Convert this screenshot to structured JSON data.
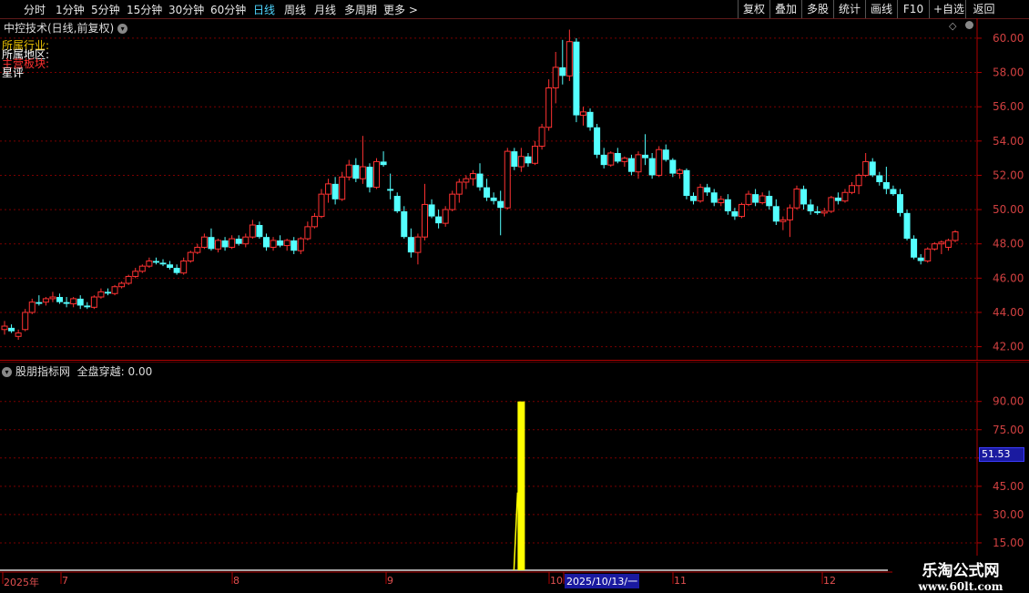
{
  "toolbar": {
    "periods": [
      "分时",
      "1分钟",
      "5分钟",
      "15分钟",
      "30分钟",
      "60分钟",
      "日线",
      "周线",
      "月线",
      "多周期",
      "更多 >"
    ],
    "active_period": "日线",
    "right_buttons": [
      "复权",
      "叠加",
      "多股",
      "统计",
      "画线",
      "F10",
      "+自选",
      "返回"
    ]
  },
  "main_panel": {
    "title": "中控技术(日线,前复权)",
    "info_lines": [
      {
        "label": "所属行业:",
        "color": "#e8c000"
      },
      {
        "label": "所属地区:",
        "color": "#ffffff"
      },
      {
        "label": "主营板块:",
        "color": "#ff3030"
      },
      {
        "label": "星评",
        "color": "#ffffff"
      }
    ],
    "y_ticks": [
      "60.00",
      "58.00",
      "56.00",
      "54.00",
      "52.00",
      "50.00",
      "48.00",
      "46.00",
      "44.00",
      "42.00"
    ],
    "up_color": "#ff3232",
    "down_color": "#54ffff"
  },
  "sub_panel": {
    "title": "股朋指标网",
    "indicator_label": "全盘穿越: 0.00",
    "y_ticks": [
      "90.00",
      "75.00",
      "60.00",
      "45.00",
      "30.00",
      "15.00"
    ],
    "current_value_box": "51.53",
    "signal_color": "#ffff00"
  },
  "x_axis": {
    "labels": [
      {
        "text": "2025年"
      },
      {
        "text": "7"
      },
      {
        "text": "8"
      },
      {
        "text": "9"
      },
      {
        "text": "10"
      },
      {
        "text": "2025/10/13/一",
        "highlight": true
      },
      {
        "text": "11"
      },
      {
        "text": "12"
      }
    ]
  },
  "watermark": {
    "line1": "乐淘公式网",
    "line2": "www.60lt.com"
  },
  "chart_data": {
    "type": "candlestick",
    "y_range": [
      41.5,
      60.9
    ],
    "candles": [
      {
        "o": 43.0,
        "h": 43.5,
        "l": 42.7,
        "c": 43.2
      },
      {
        "o": 43.1,
        "h": 43.3,
        "l": 42.8,
        "c": 42.9
      },
      {
        "o": 42.6,
        "h": 43.0,
        "l": 42.4,
        "c": 42.8
      },
      {
        "o": 43.0,
        "h": 44.2,
        "l": 42.9,
        "c": 44.0
      },
      {
        "o": 44.0,
        "h": 44.8,
        "l": 43.9,
        "c": 44.6
      },
      {
        "o": 44.6,
        "h": 45.0,
        "l": 44.4,
        "c": 44.5
      },
      {
        "o": 44.6,
        "h": 44.9,
        "l": 44.4,
        "c": 44.8
      },
      {
        "o": 44.8,
        "h": 45.2,
        "l": 44.6,
        "c": 44.9
      },
      {
        "o": 44.9,
        "h": 45.1,
        "l": 44.5,
        "c": 44.6
      },
      {
        "o": 44.6,
        "h": 44.9,
        "l": 44.3,
        "c": 44.5
      },
      {
        "o": 44.5,
        "h": 44.9,
        "l": 44.3,
        "c": 44.8
      },
      {
        "o": 44.8,
        "h": 45.0,
        "l": 44.2,
        "c": 44.4
      },
      {
        "o": 44.4,
        "h": 44.6,
        "l": 44.2,
        "c": 44.3
      },
      {
        "o": 44.3,
        "h": 45.0,
        "l": 44.2,
        "c": 44.9
      },
      {
        "o": 44.9,
        "h": 45.4,
        "l": 44.8,
        "c": 45.2
      },
      {
        "o": 45.2,
        "h": 45.4,
        "l": 45.0,
        "c": 45.1
      },
      {
        "o": 45.1,
        "h": 45.6,
        "l": 45.0,
        "c": 45.5
      },
      {
        "o": 45.5,
        "h": 45.8,
        "l": 45.4,
        "c": 45.7
      },
      {
        "o": 45.7,
        "h": 46.2,
        "l": 45.6,
        "c": 46.1
      },
      {
        "o": 46.1,
        "h": 46.6,
        "l": 46.0,
        "c": 46.4
      },
      {
        "o": 46.4,
        "h": 46.8,
        "l": 46.3,
        "c": 46.7
      },
      {
        "o": 46.7,
        "h": 47.2,
        "l": 46.6,
        "c": 47.0
      },
      {
        "o": 47.0,
        "h": 47.2,
        "l": 46.8,
        "c": 46.9
      },
      {
        "o": 46.9,
        "h": 47.1,
        "l": 46.7,
        "c": 46.8
      },
      {
        "o": 46.8,
        "h": 47.0,
        "l": 46.5,
        "c": 46.6
      },
      {
        "o": 46.6,
        "h": 46.8,
        "l": 46.2,
        "c": 46.3
      },
      {
        "o": 46.3,
        "h": 47.2,
        "l": 46.2,
        "c": 47.0
      },
      {
        "o": 47.0,
        "h": 47.6,
        "l": 46.9,
        "c": 47.5
      },
      {
        "o": 47.5,
        "h": 48.0,
        "l": 47.4,
        "c": 47.8
      },
      {
        "o": 47.8,
        "h": 48.6,
        "l": 47.7,
        "c": 48.4
      },
      {
        "o": 48.4,
        "h": 48.9,
        "l": 47.6,
        "c": 47.7
      },
      {
        "o": 47.7,
        "h": 48.3,
        "l": 47.5,
        "c": 48.2
      },
      {
        "o": 48.2,
        "h": 48.4,
        "l": 47.6,
        "c": 47.8
      },
      {
        "o": 47.8,
        "h": 48.5,
        "l": 47.7,
        "c": 48.3
      },
      {
        "o": 48.3,
        "h": 48.5,
        "l": 47.9,
        "c": 48.0
      },
      {
        "o": 48.0,
        "h": 48.6,
        "l": 47.8,
        "c": 48.4
      },
      {
        "o": 48.4,
        "h": 49.4,
        "l": 48.3,
        "c": 49.1
      },
      {
        "o": 49.1,
        "h": 49.3,
        "l": 48.3,
        "c": 48.4
      },
      {
        "o": 48.4,
        "h": 48.6,
        "l": 47.6,
        "c": 47.8
      },
      {
        "o": 47.8,
        "h": 48.4,
        "l": 47.6,
        "c": 48.2
      },
      {
        "o": 48.2,
        "h": 48.5,
        "l": 47.8,
        "c": 47.9
      },
      {
        "o": 47.9,
        "h": 48.3,
        "l": 47.6,
        "c": 48.2
      },
      {
        "o": 48.2,
        "h": 48.4,
        "l": 47.4,
        "c": 47.6
      },
      {
        "o": 47.6,
        "h": 48.4,
        "l": 47.4,
        "c": 48.3
      },
      {
        "o": 48.3,
        "h": 49.3,
        "l": 48.2,
        "c": 49.0
      },
      {
        "o": 49.0,
        "h": 49.8,
        "l": 48.9,
        "c": 49.6
      },
      {
        "o": 49.6,
        "h": 51.2,
        "l": 49.5,
        "c": 50.9
      },
      {
        "o": 50.9,
        "h": 51.8,
        "l": 50.4,
        "c": 51.5
      },
      {
        "o": 51.5,
        "h": 51.9,
        "l": 50.3,
        "c": 50.6
      },
      {
        "o": 50.6,
        "h": 52.2,
        "l": 50.5,
        "c": 51.9
      },
      {
        "o": 51.9,
        "h": 52.9,
        "l": 51.7,
        "c": 52.6
      },
      {
        "o": 52.6,
        "h": 53.0,
        "l": 51.6,
        "c": 51.8
      },
      {
        "o": 51.8,
        "h": 54.3,
        "l": 51.5,
        "c": 52.5
      },
      {
        "o": 52.5,
        "h": 52.7,
        "l": 51.0,
        "c": 51.3
      },
      {
        "o": 51.3,
        "h": 53.0,
        "l": 51.2,
        "c": 52.8
      },
      {
        "o": 52.8,
        "h": 53.4,
        "l": 52.5,
        "c": 52.6
      },
      {
        "o": 51.2,
        "h": 52.1,
        "l": 50.6,
        "c": 51.1
      },
      {
        "o": 50.8,
        "h": 51.0,
        "l": 49.8,
        "c": 49.9
      },
      {
        "o": 49.9,
        "h": 50.2,
        "l": 48.3,
        "c": 48.4
      },
      {
        "o": 48.4,
        "h": 48.9,
        "l": 47.2,
        "c": 47.5
      },
      {
        "o": 47.5,
        "h": 48.6,
        "l": 46.8,
        "c": 48.4
      },
      {
        "o": 48.4,
        "h": 51.5,
        "l": 48.2,
        "c": 50.3
      },
      {
        "o": 50.3,
        "h": 50.6,
        "l": 49.5,
        "c": 49.6
      },
      {
        "o": 49.6,
        "h": 50.0,
        "l": 48.9,
        "c": 49.2
      },
      {
        "o": 49.2,
        "h": 50.2,
        "l": 49.0,
        "c": 50.0
      },
      {
        "o": 50.0,
        "h": 51.1,
        "l": 49.9,
        "c": 50.9
      },
      {
        "o": 50.9,
        "h": 51.8,
        "l": 50.4,
        "c": 51.6
      },
      {
        "o": 51.6,
        "h": 52.0,
        "l": 51.2,
        "c": 51.8
      },
      {
        "o": 51.8,
        "h": 52.3,
        "l": 51.4,
        "c": 52.1
      },
      {
        "o": 52.1,
        "h": 52.7,
        "l": 51.1,
        "c": 51.3
      },
      {
        "o": 51.3,
        "h": 51.8,
        "l": 50.5,
        "c": 50.7
      },
      {
        "o": 50.7,
        "h": 51.0,
        "l": 50.3,
        "c": 50.5
      },
      {
        "o": 50.5,
        "h": 51.1,
        "l": 48.5,
        "c": 50.1
      },
      {
        "o": 50.1,
        "h": 53.6,
        "l": 50.0,
        "c": 53.4
      },
      {
        "o": 53.4,
        "h": 53.6,
        "l": 52.3,
        "c": 52.5
      },
      {
        "o": 52.5,
        "h": 53.6,
        "l": 52.2,
        "c": 53.1
      },
      {
        "o": 53.1,
        "h": 53.3,
        "l": 52.5,
        "c": 52.7
      },
      {
        "o": 52.7,
        "h": 54.0,
        "l": 52.6,
        "c": 53.7
      },
      {
        "o": 53.7,
        "h": 55.0,
        "l": 53.5,
        "c": 54.8
      },
      {
        "o": 54.8,
        "h": 57.6,
        "l": 54.6,
        "c": 57.1
      },
      {
        "o": 57.1,
        "h": 59.2,
        "l": 56.2,
        "c": 58.3
      },
      {
        "o": 58.3,
        "h": 59.9,
        "l": 57.3,
        "c": 57.8
      },
      {
        "o": 57.8,
        "h": 60.5,
        "l": 57.5,
        "c": 59.8
      },
      {
        "o": 59.8,
        "h": 60.0,
        "l": 55.1,
        "c": 55.5
      },
      {
        "o": 55.5,
        "h": 56.0,
        "l": 54.9,
        "c": 55.7
      },
      {
        "o": 55.7,
        "h": 55.9,
        "l": 54.6,
        "c": 54.8
      },
      {
        "o": 54.8,
        "h": 55.0,
        "l": 53.0,
        "c": 53.2
      },
      {
        "o": 53.2,
        "h": 53.6,
        "l": 52.4,
        "c": 52.6
      },
      {
        "o": 52.6,
        "h": 53.4,
        "l": 52.5,
        "c": 53.3
      },
      {
        "o": 53.3,
        "h": 53.6,
        "l": 52.7,
        "c": 52.8
      },
      {
        "o": 52.8,
        "h": 53.1,
        "l": 52.5,
        "c": 53.0
      },
      {
        "o": 53.0,
        "h": 53.2,
        "l": 52.0,
        "c": 52.2
      },
      {
        "o": 52.2,
        "h": 53.4,
        "l": 51.8,
        "c": 53.2
      },
      {
        "o": 53.2,
        "h": 54.4,
        "l": 52.6,
        "c": 53.0
      },
      {
        "o": 53.0,
        "h": 53.3,
        "l": 51.8,
        "c": 52.0
      },
      {
        "o": 52.0,
        "h": 53.7,
        "l": 51.9,
        "c": 53.5
      },
      {
        "o": 53.5,
        "h": 53.8,
        "l": 52.8,
        "c": 52.9
      },
      {
        "o": 52.9,
        "h": 53.0,
        "l": 51.9,
        "c": 52.1
      },
      {
        "o": 52.1,
        "h": 52.4,
        "l": 51.8,
        "c": 52.3
      },
      {
        "o": 52.3,
        "h": 52.4,
        "l": 50.6,
        "c": 50.8
      },
      {
        "o": 50.8,
        "h": 51.0,
        "l": 50.3,
        "c": 50.5
      },
      {
        "o": 50.5,
        "h": 51.5,
        "l": 50.4,
        "c": 51.3
      },
      {
        "o": 51.3,
        "h": 51.5,
        "l": 50.8,
        "c": 51.0
      },
      {
        "o": 51.0,
        "h": 51.2,
        "l": 50.2,
        "c": 50.4
      },
      {
        "o": 50.4,
        "h": 50.8,
        "l": 50.2,
        "c": 50.6
      },
      {
        "o": 50.6,
        "h": 50.9,
        "l": 49.7,
        "c": 49.9
      },
      {
        "o": 49.9,
        "h": 50.1,
        "l": 49.4,
        "c": 49.6
      },
      {
        "o": 49.6,
        "h": 50.4,
        "l": 49.5,
        "c": 50.3
      },
      {
        "o": 50.3,
        "h": 51.1,
        "l": 50.2,
        "c": 50.9
      },
      {
        "o": 50.9,
        "h": 51.2,
        "l": 50.2,
        "c": 50.4
      },
      {
        "o": 50.4,
        "h": 51.0,
        "l": 50.3,
        "c": 50.8
      },
      {
        "o": 50.8,
        "h": 51.1,
        "l": 50.0,
        "c": 50.2
      },
      {
        "o": 50.2,
        "h": 50.6,
        "l": 49.1,
        "c": 49.3
      },
      {
        "o": 49.3,
        "h": 49.6,
        "l": 48.8,
        "c": 49.4
      },
      {
        "o": 49.4,
        "h": 50.3,
        "l": 48.4,
        "c": 50.1
      },
      {
        "o": 50.1,
        "h": 51.4,
        "l": 50.0,
        "c": 51.2
      },
      {
        "o": 51.2,
        "h": 51.4,
        "l": 50.0,
        "c": 50.3
      },
      {
        "o": 50.3,
        "h": 50.6,
        "l": 49.7,
        "c": 49.9
      },
      {
        "o": 49.9,
        "h": 50.2,
        "l": 49.7,
        "c": 49.8
      },
      {
        "o": 49.8,
        "h": 50.1,
        "l": 49.6,
        "c": 49.9
      },
      {
        "o": 49.9,
        "h": 50.8,
        "l": 49.8,
        "c": 50.7
      },
      {
        "o": 50.7,
        "h": 51.0,
        "l": 50.3,
        "c": 50.5
      },
      {
        "o": 50.5,
        "h": 51.2,
        "l": 50.4,
        "c": 51.0
      },
      {
        "o": 51.0,
        "h": 51.6,
        "l": 50.9,
        "c": 51.4
      },
      {
        "o": 51.4,
        "h": 52.1,
        "l": 50.9,
        "c": 52.0
      },
      {
        "o": 52.0,
        "h": 53.3,
        "l": 51.9,
        "c": 52.8
      },
      {
        "o": 52.8,
        "h": 53.0,
        "l": 51.9,
        "c": 52.0
      },
      {
        "o": 52.0,
        "h": 52.2,
        "l": 51.4,
        "c": 51.6
      },
      {
        "o": 51.6,
        "h": 52.5,
        "l": 50.9,
        "c": 51.2
      },
      {
        "o": 51.2,
        "h": 51.4,
        "l": 50.8,
        "c": 50.9
      },
      {
        "o": 50.9,
        "h": 51.2,
        "l": 49.6,
        "c": 49.8
      },
      {
        "o": 49.8,
        "h": 50.0,
        "l": 48.2,
        "c": 48.3
      },
      {
        "o": 48.3,
        "h": 48.5,
        "l": 47.1,
        "c": 47.2
      },
      {
        "o": 47.2,
        "h": 47.4,
        "l": 46.8,
        "c": 47.0
      },
      {
        "o": 47.0,
        "h": 47.8,
        "l": 46.9,
        "c": 47.7
      },
      {
        "o": 47.7,
        "h": 48.1,
        "l": 47.6,
        "c": 48.0
      },
      {
        "o": 48.0,
        "h": 48.2,
        "l": 47.4,
        "c": 48.1
      },
      {
        "o": 47.8,
        "h": 48.3,
        "l": 47.6,
        "c": 48.2
      },
      {
        "o": 48.2,
        "h": 48.8,
        "l": 48.1,
        "c": 48.7
      }
    ],
    "indicator": {
      "name": "全盘穿越",
      "y_range": [
        0,
        100
      ],
      "spike": {
        "candle_index": 75,
        "value": 90
      }
    }
  }
}
